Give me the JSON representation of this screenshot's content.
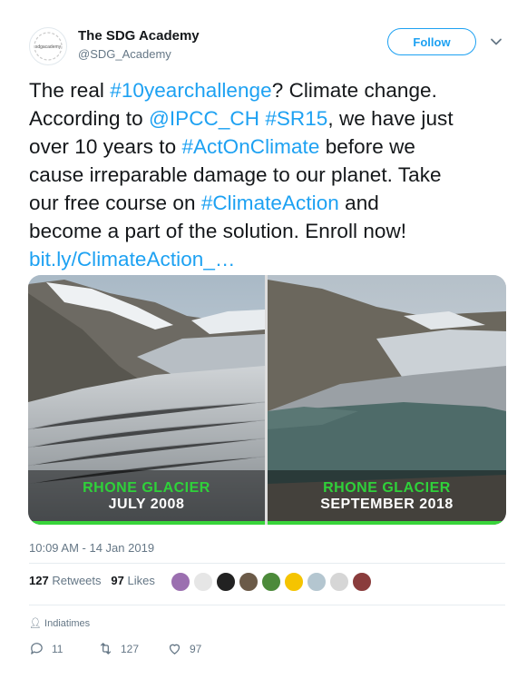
{
  "author": {
    "name": "The SDG Academy",
    "handle": "@SDG_Academy",
    "avatar_text": "sdgacademy"
  },
  "follow_label": "Follow",
  "tweet": {
    "lines": [
      [
        {
          "t": "The real "
        },
        {
          "t": "#10yearchallenge",
          "link": true
        },
        {
          "t": "? Climate change."
        }
      ],
      [
        {
          "t": "According to "
        },
        {
          "t": "@IPCC_CH",
          "link": true
        },
        {
          "t": " "
        },
        {
          "t": "#SR15",
          "link": true
        },
        {
          "t": ", we have just"
        }
      ],
      [
        {
          "t": "over 10 years to "
        },
        {
          "t": "#ActOnClimate",
          "link": true
        },
        {
          "t": " before we"
        }
      ],
      [
        {
          "t": "cause irreparable damage to our planet. Take"
        }
      ],
      [
        {
          "t": "our free course on "
        },
        {
          "t": "#ClimateAction",
          "link": true
        },
        {
          "t": " and"
        }
      ],
      [
        {
          "t": "become a part of the solution. Enroll now!"
        }
      ],
      [
        {
          "t": "bit.ly/ClimateAction_…",
          "link": true
        }
      ]
    ]
  },
  "media": {
    "left": {
      "title": "RHONE GLACIER",
      "date": "JULY 2008"
    },
    "right": {
      "title": "RHONE GLACIER",
      "date": "SEPTEMBER 2018"
    },
    "accent": "#38d43a"
  },
  "timestamp": "10:09 AM - 14 Jan 2019",
  "stats": {
    "retweets_count": "127",
    "retweets_label": "Retweets",
    "likes_count": "97",
    "likes_label": "Likes"
  },
  "via": "Indiatimes",
  "actions": {
    "replies": "11",
    "retweets": "127",
    "likes": "97"
  },
  "colors": {
    "link": "#1da1f2",
    "secondary_text": "#657786",
    "primary_text": "#14171a"
  }
}
